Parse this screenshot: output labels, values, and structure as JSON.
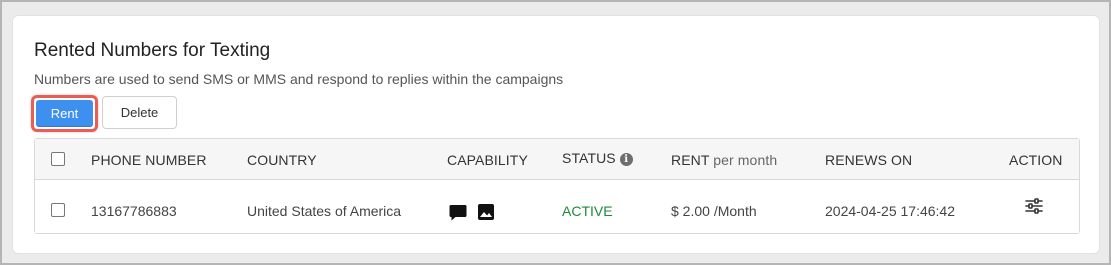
{
  "header": {
    "title": "Rented Numbers for Texting",
    "subtitle": "Numbers are used to send SMS or MMS and respond to replies within the campaigns"
  },
  "toolbar": {
    "rent_label": "Rent",
    "delete_label": "Delete"
  },
  "table": {
    "columns": {
      "phone_number": "PHONE NUMBER",
      "country": "COUNTRY",
      "capability": "CAPABILITY",
      "status": "STATUS",
      "rent": "RENT",
      "rent_suffix": "per month",
      "renews_on": "RENEWS ON",
      "action": "ACTION"
    },
    "status_info_icon": "info-icon",
    "rows": [
      {
        "phone_number": "13167786883",
        "country": "United States of America",
        "capabilities": [
          "sms-icon",
          "mms-image-icon"
        ],
        "status": "ACTIVE",
        "rent": "$ 2.00 /Month",
        "renews_on": "2024-04-25 17:46:42",
        "action_icon": "settings-sliders-icon"
      }
    ]
  },
  "colors": {
    "primary": "#3d8ff0",
    "highlight": "#e85e57",
    "status_active": "#1f8a3c"
  }
}
